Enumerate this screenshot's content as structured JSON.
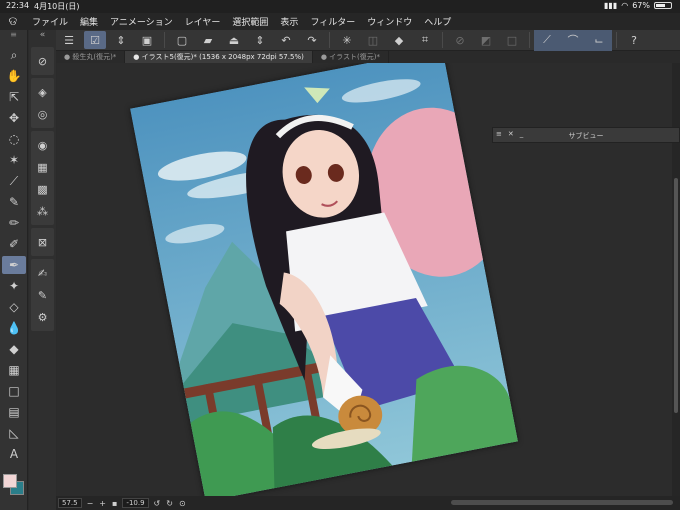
{
  "status": {
    "time": "22:34",
    "date": "4月10日(日)",
    "battery": "67%",
    "battery_level": 0.67
  },
  "menu": {
    "items": [
      "ファイル",
      "編集",
      "アニメーション",
      "レイヤー",
      "選択範囲",
      "表示",
      "フィルター",
      "ウィンドウ",
      "ヘルプ"
    ]
  },
  "tabs": [
    {
      "label": "● 殺生丸(復元)*"
    },
    {
      "label": "● イラスト5(復元)* (1536 x 2048px 72dpi 57.5%)"
    },
    {
      "label": "● イラスト(復元)*"
    }
  ],
  "subview": {
    "title": "サブビュー",
    "close": "✕",
    "minimize": "_"
  },
  "bottom": {
    "zoom": "57.5",
    "rotation": "-10.9",
    "minus": "−",
    "plus": "+"
  },
  "colors": {
    "main": "#f2d6d6",
    "sub": "#2a7e8a",
    "accent": "#6a7c9c"
  }
}
